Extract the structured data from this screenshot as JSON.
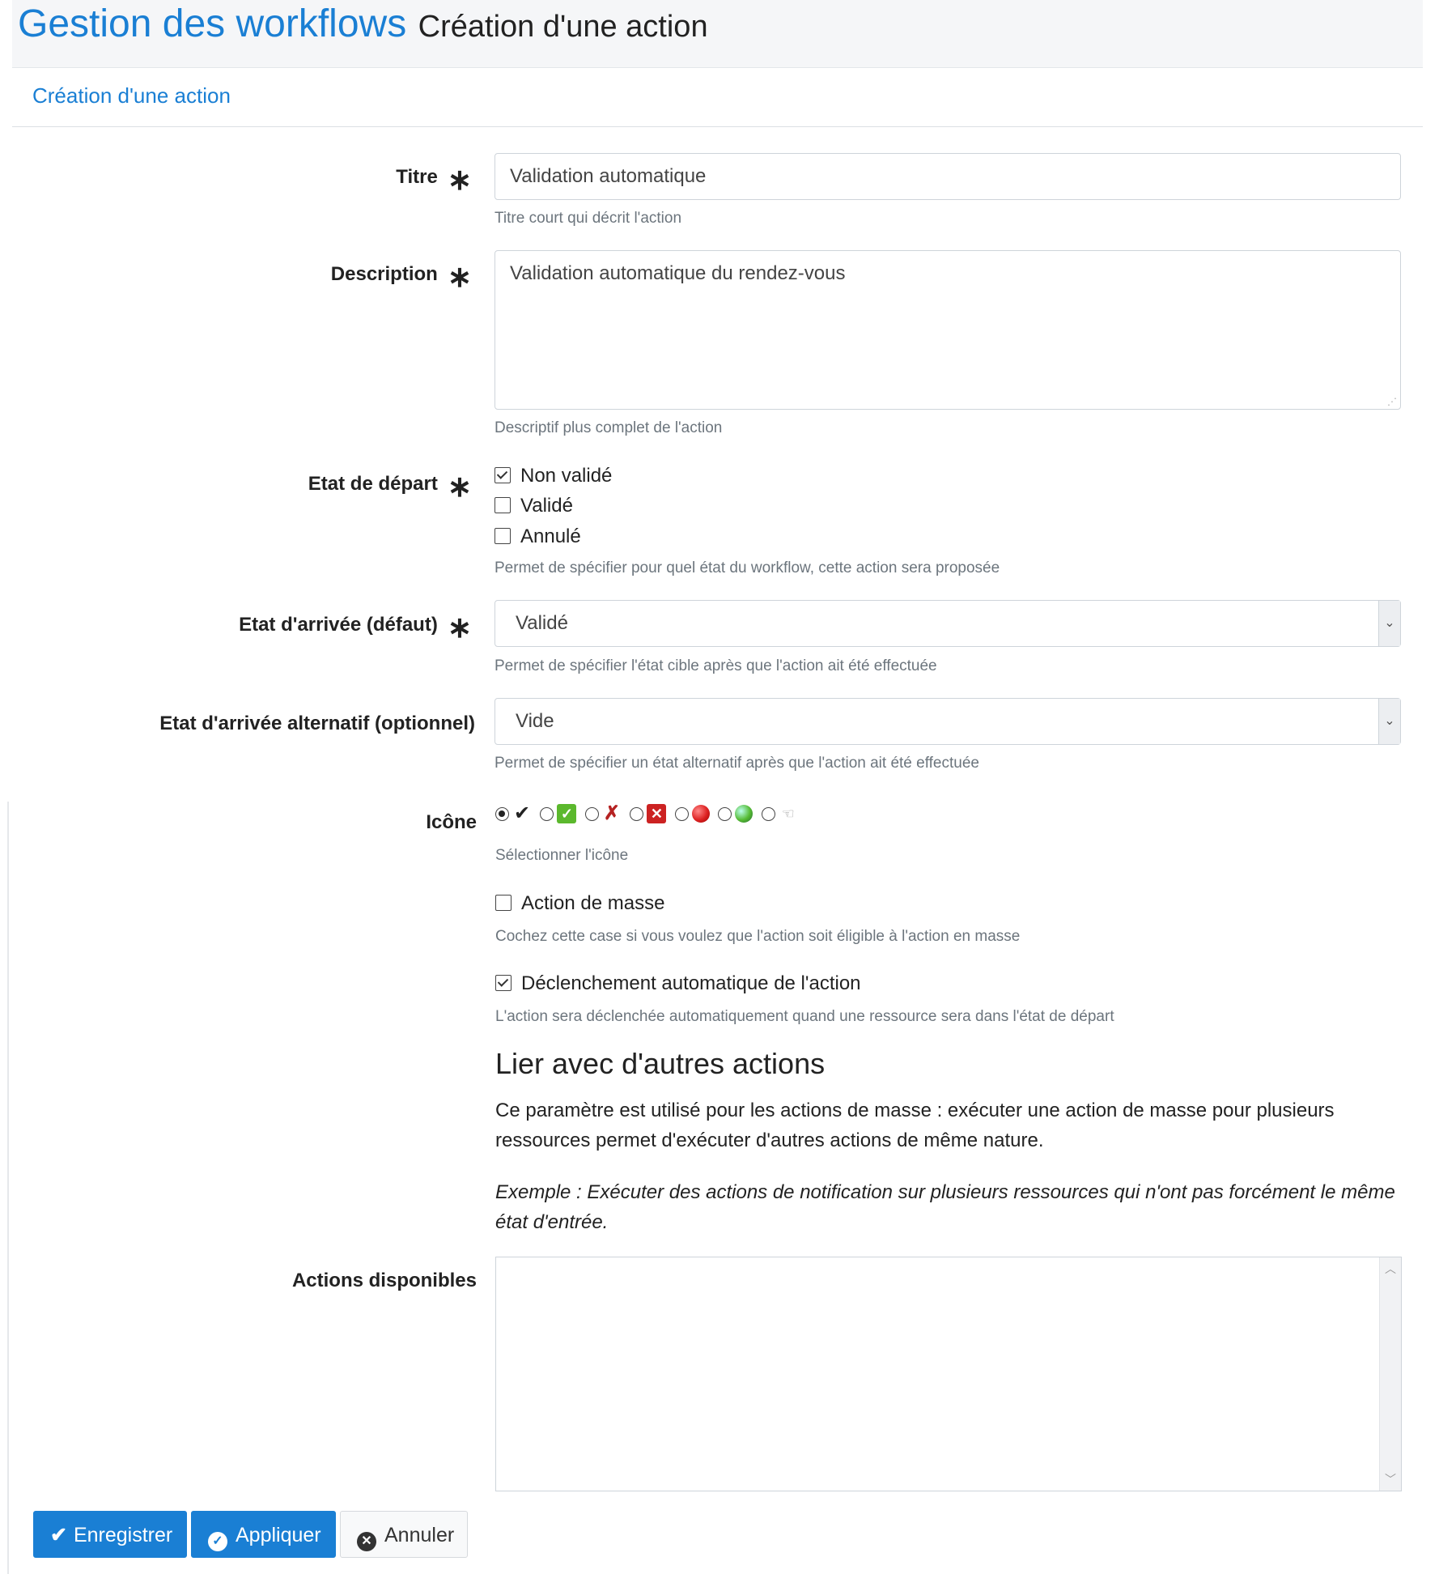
{
  "header": {
    "title": "Gestion des workflows",
    "subtitle": "Création d'une action"
  },
  "tab": {
    "label": "Création d'une action"
  },
  "form": {
    "titre": {
      "label": "Titre",
      "required": "∗",
      "value": "Validation automatique",
      "help": "Titre court qui décrit l'action"
    },
    "description": {
      "label": "Description",
      "required": "∗",
      "value": "Validation automatique du rendez-vous",
      "help": "Descriptif plus complet de l'action"
    },
    "etat_depart": {
      "label": "Etat de départ",
      "required": "∗",
      "options": [
        {
          "label": "Non validé",
          "checked": true
        },
        {
          "label": "Validé",
          "checked": false
        },
        {
          "label": "Annulé",
          "checked": false
        }
      ],
      "help": "Permet de spécifier pour quel état du workflow, cette action sera proposée"
    },
    "etat_arrivee": {
      "label": "Etat d'arrivée (défaut)",
      "required": "∗",
      "value": "Validé",
      "help": "Permet de spécifier l'état cible après que l'action ait été effectuée"
    },
    "etat_arrivee_alt": {
      "label": "Etat d'arrivée alternatif (optionnel)",
      "value": "Vide",
      "help": "Permet de spécifier un état alternatif après que l'action ait été effectuée"
    },
    "icone": {
      "label": "Icône",
      "options": [
        {
          "icon": "checkmark-icon",
          "selected": true
        },
        {
          "icon": "green-check-box-icon",
          "selected": false
        },
        {
          "icon": "red-x-icon",
          "selected": false
        },
        {
          "icon": "red-x-box-icon",
          "selected": false
        },
        {
          "icon": "red-ball-icon",
          "selected": false
        },
        {
          "icon": "green-ball-icon",
          "selected": false
        },
        {
          "icon": "hand-pointer-icon",
          "selected": false
        }
      ],
      "help": "Sélectionner l'icône"
    },
    "action_masse": {
      "label": "Action de masse",
      "checked": false,
      "help": "Cochez cette case si vous voulez que l'action soit éligible à l'action en masse"
    },
    "declenchement_auto": {
      "label": "Déclenchement automatique de l'action",
      "checked": true,
      "help": "L'action sera déclenchée automatiquement quand une ressource sera dans l'état de départ"
    }
  },
  "linked": {
    "title": "Lier avec d'autres actions",
    "paragraph": "Ce paramètre est utilisé pour les actions de masse : exécuter une action de masse pour plusieurs ressources permet d'exécuter d'autres actions de même nature.",
    "example": "Exemple : Exécuter des actions de notification sur plusieurs ressources qui n'ont pas forcément le même état d'entrée.",
    "actions_label": "Actions disponibles"
  },
  "buttons": {
    "save": "Enregistrer",
    "apply": "Appliquer",
    "cancel": "Annuler"
  },
  "colors": {
    "primary": "#1a7fd4",
    "header_bg": "#f5f6f8"
  }
}
